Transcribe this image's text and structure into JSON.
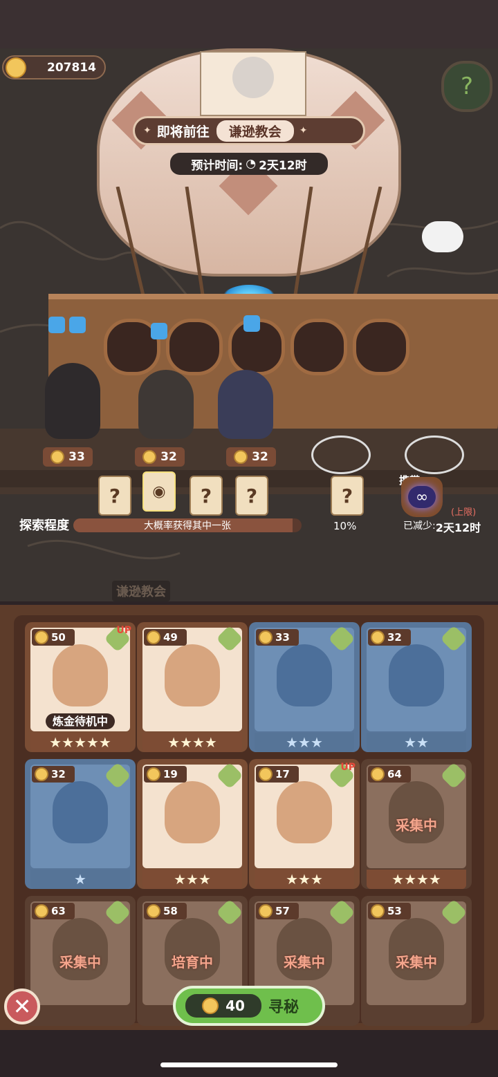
{
  "currency": {
    "amount": "207814",
    "icon": "crown-coin-icon"
  },
  "help": {
    "icon": "question-leaf-icon"
  },
  "destination": {
    "prefix": "即将前往",
    "name": "谦逊教会"
  },
  "eta": {
    "label": "预计时间:",
    "value": "2天12时",
    "icon": "clock-icon"
  },
  "party": [
    {
      "level": "33",
      "role": "skull-girl"
    },
    {
      "level": "32",
      "role": "sleepy-boy"
    },
    {
      "level": "32",
      "role": "blue-hair-girl"
    }
  ],
  "rewards": [
    "?",
    "?",
    "?",
    "?"
  ],
  "bonus_reward": {
    "symbol": "?",
    "percent": "10%"
  },
  "exploration": {
    "label": "探索程度",
    "bar_text": "大概率获得其中一张",
    "progress": 0.96
  },
  "carry": {
    "label": "携带",
    "limit": "(上限)",
    "reduced_label": "已减少:",
    "reduced_value": "2天12时",
    "icon": "infinity-icon"
  },
  "map_label": "谦逊教会",
  "cards": [
    {
      "level": "50",
      "stars": "★★★★★",
      "status": "炼金待机中",
      "up": "UP",
      "type": "normal"
    },
    {
      "level": "49",
      "stars": "★★★★",
      "status": "",
      "up": "",
      "type": "normal"
    },
    {
      "level": "33",
      "stars": "★★★",
      "status": "",
      "up": "",
      "type": "locked"
    },
    {
      "level": "32",
      "stars": "★★",
      "status": "",
      "up": "",
      "type": "locked"
    },
    {
      "level": "32",
      "stars": "★",
      "status": "",
      "up": "",
      "type": "locked"
    },
    {
      "level": "19",
      "stars": "★★★",
      "status": "",
      "up": "",
      "type": "normal"
    },
    {
      "level": "17",
      "stars": "★★★",
      "status": "",
      "up": "UP",
      "type": "normal"
    },
    {
      "level": "64",
      "stars": "★★★★",
      "status": "采集中",
      "up": "",
      "type": "busy"
    },
    {
      "level": "63",
      "stars": "",
      "status": "采集中",
      "up": "",
      "type": "busy"
    },
    {
      "level": "58",
      "stars": "",
      "status": "培育中",
      "up": "",
      "type": "busy"
    },
    {
      "level": "57",
      "stars": "",
      "status": "采集中",
      "up": "",
      "type": "busy"
    },
    {
      "level": "53",
      "stars": "",
      "status": "采集中",
      "up": "",
      "type": "busy"
    }
  ],
  "seek": {
    "cost": "40",
    "label": "寻秘"
  },
  "close": {
    "icon": "close-icon"
  },
  "colors": {
    "accent_green": "#6fbf4c",
    "panel_brown": "#5d3c2a",
    "locked_blue": "#58769a"
  }
}
